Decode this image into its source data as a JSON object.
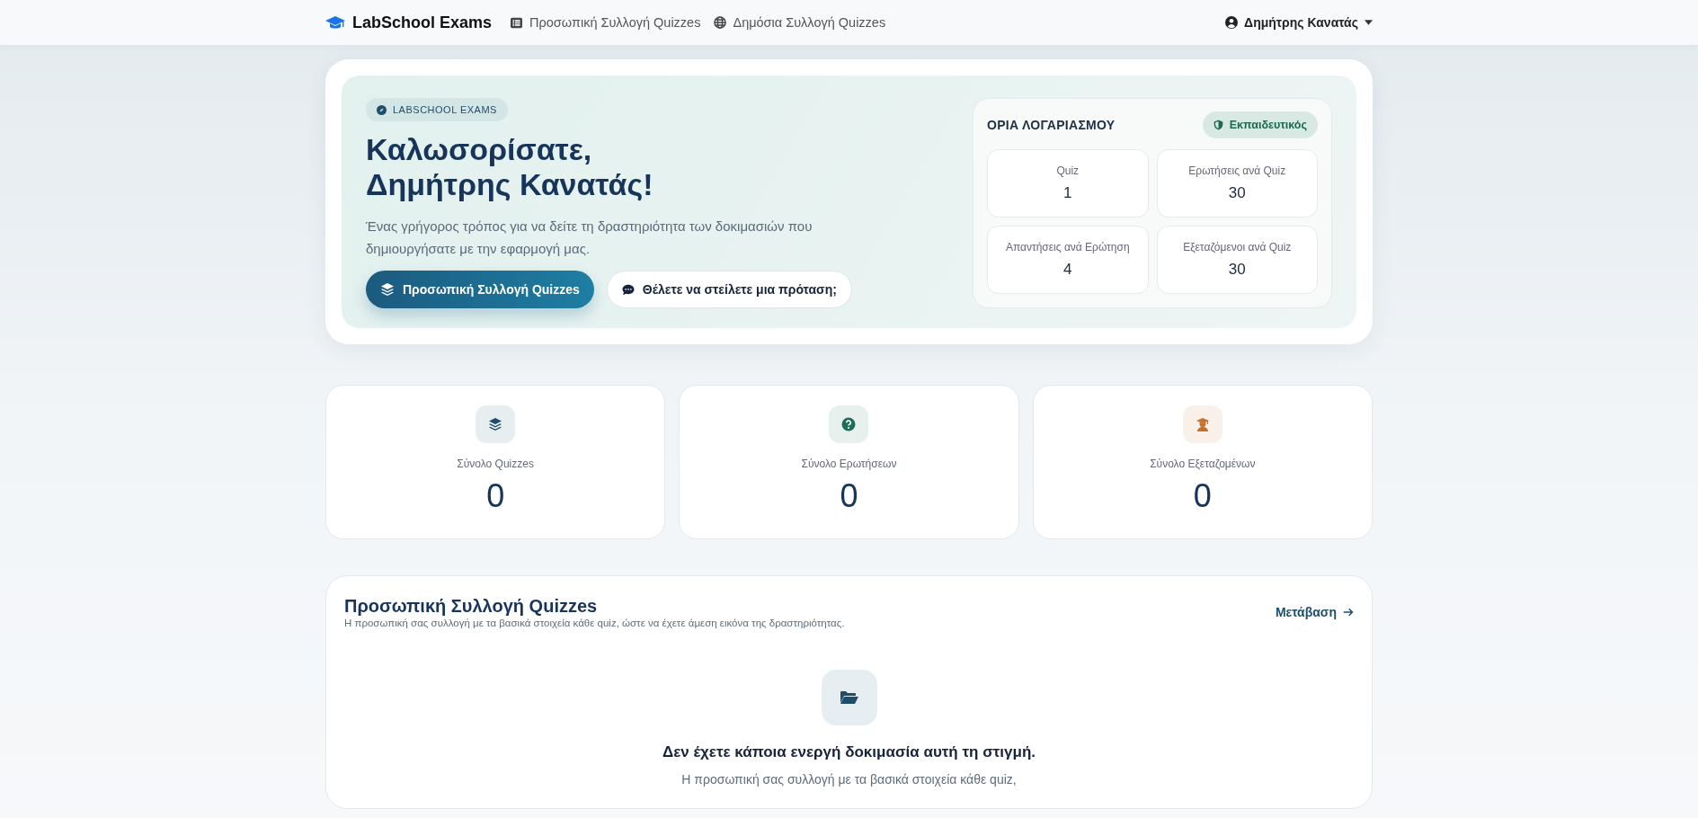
{
  "navbar": {
    "brand": "LabSchool Exams",
    "links": [
      {
        "label": "Προσωπική Συλλογή Quizzes"
      },
      {
        "label": "Δημόσια Συλλογή Quizzes"
      }
    ],
    "user": "Δημήτρης Κανατάς"
  },
  "hero": {
    "badge": "LABSCHOOL EXAMS",
    "title_line_1": "Καλωσορίσατε,",
    "title_line_2": "Δημήτρης Κανατάς!",
    "description": "Ένας γρήγορος τρόπος για να δείτε τη δραστηριότητα των δοκιμασιών που δημιουργήσατε με την εφαρμογή μας.",
    "buttons": [
      {
        "label": "Προσωπική Συλλογή Quizzes",
        "kind": "primary"
      },
      {
        "label": "Θέλετε να στείλετε μια πρόταση;",
        "kind": "secondary"
      }
    ],
    "limits": {
      "title": "ΟΡΙΑ ΛΟΓΑΡΙΑΣΜΟΥ",
      "role": "Εκπαιδευτικός",
      "items": [
        {
          "label": "Quiz",
          "value": "1"
        },
        {
          "label": "Ερωτήσεις ανά Quiz",
          "value": "30"
        },
        {
          "label": "Απαντήσεις ανά Ερώτηση",
          "value": "4"
        },
        {
          "label": "Εξεταζόμενοι ανά Quiz",
          "value": "30"
        }
      ]
    }
  },
  "stats": [
    {
      "label": "Σύνολο Quizzes",
      "value": "0",
      "color": "#1d4e6b"
    },
    {
      "label": "Σύνολο Ερωτήσεων",
      "value": "0",
      "color": "#1f6e5c"
    },
    {
      "label": "Σύνολο Εξεταζομένων",
      "value": "0",
      "color": "#c8702a"
    }
  ],
  "collection": {
    "title": "Προσωπική Συλλογή Quizzes",
    "subtitle": "Η προσωπική σας συλλογή με τα βασικά στοιχεία κάθε quiz, ώστε να έχετε άμεση εικόνα της δραστηριότητας.",
    "link": "Μετάβαση",
    "empty_title": "Δεν έχετε κάποια ενεργή δοκιμασία αυτή τη στιγμή.",
    "empty_text": "Η προσωπική σας συλλογή με τα βασικά στοιχεία κάθε quiz,"
  }
}
